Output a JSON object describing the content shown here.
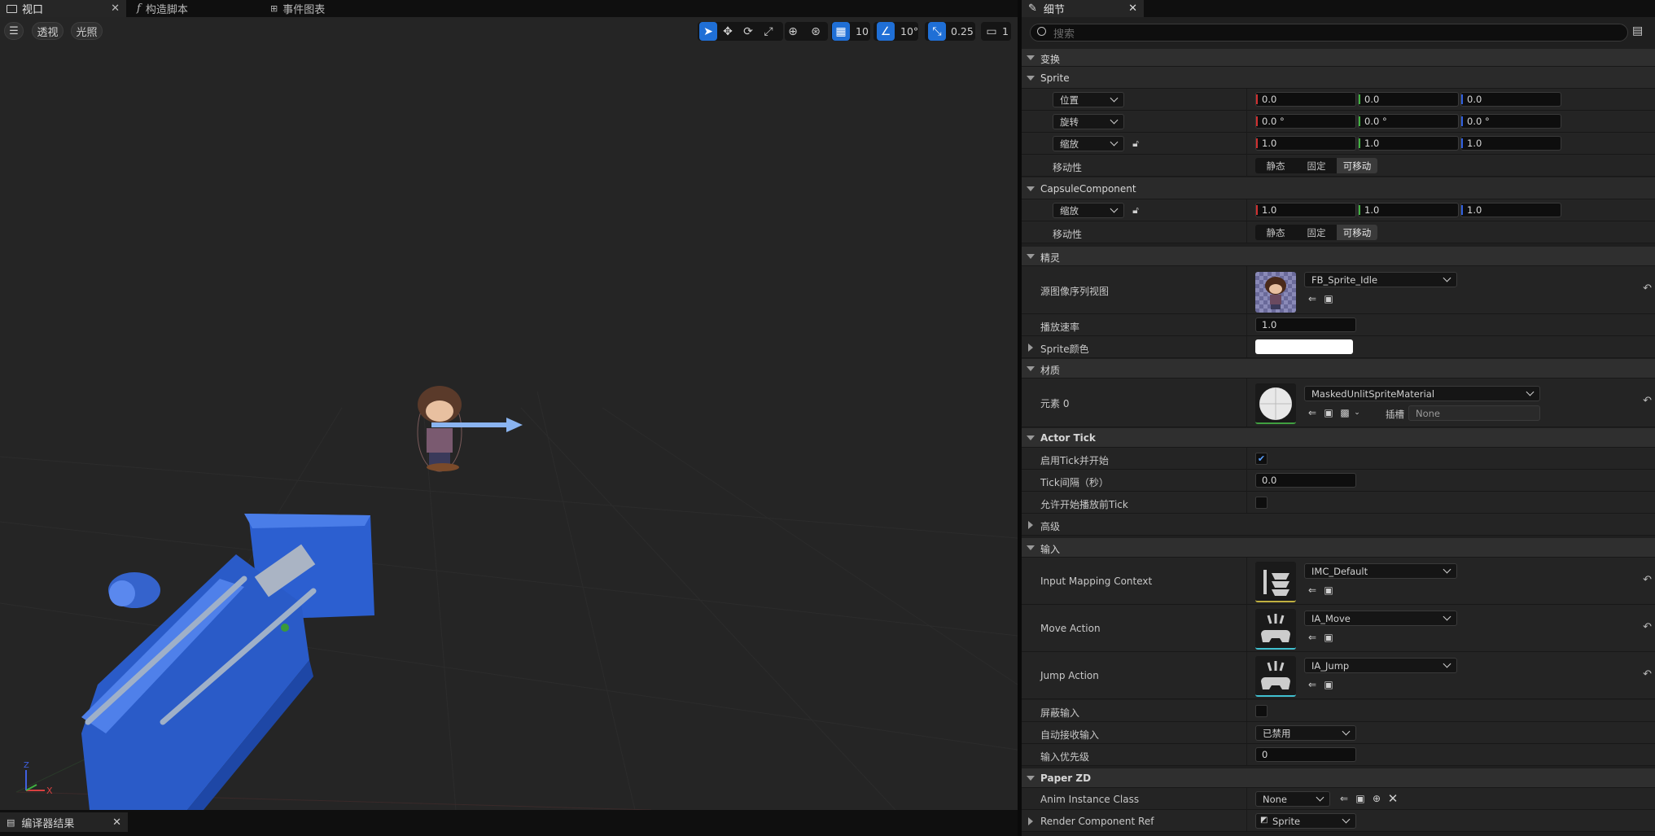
{
  "left_tabs": [
    {
      "label": "视口",
      "icon": "viewport-icon"
    },
    {
      "label": "构造脚本",
      "icon": "function-icon"
    },
    {
      "label": "事件图表",
      "icon": "event-graph-icon"
    }
  ],
  "viewport": {
    "view_mode": "透视",
    "lighting": "光照",
    "grid_snap": "10",
    "rotation_snap": "10°",
    "scale_snap": "0.25",
    "camera_speed": "1",
    "axis_x": "X",
    "axis_z": "Z"
  },
  "bottom_tab": {
    "label": "编译器结果"
  },
  "details": {
    "tab_label": "细节",
    "search_placeholder": "搜索",
    "sections": {
      "transform": "变换",
      "sprite": "Sprite",
      "capsule": "CapsuleComponent",
      "sprite_cn": "精灵",
      "material": "材质",
      "actor_tick": "Actor Tick",
      "advanced": "高级",
      "input": "输入",
      "paper_zd": "Paper ZD"
    },
    "transform": {
      "location_label": "位置",
      "location": [
        "0.0",
        "0.0",
        "0.0"
      ],
      "rotation_label": "旋转",
      "rotation": [
        "0.0 °",
        "0.0 °",
        "0.0 °"
      ],
      "scale_label": "缩放",
      "scale": [
        "1.0",
        "1.0",
        "1.0"
      ],
      "mobility_label": "移动性",
      "mobility_options": [
        "静态",
        "固定",
        "可移动"
      ]
    },
    "capsule": {
      "scale_label": "缩放",
      "scale": [
        "1.0",
        "1.0",
        "1.0"
      ],
      "mobility_label": "移动性",
      "mobility_options": [
        "静态",
        "固定",
        "可移动"
      ]
    },
    "sprite": {
      "source_flipbook_label": "源图像序列视图",
      "source_flipbook": "FB_Sprite_Idle",
      "play_rate_label": "播放速率",
      "play_rate": "1.0",
      "color_label": "Sprite颜色"
    },
    "material": {
      "element_label": "元素 0",
      "element_value": "MaskedUnlitSpriteMaterial",
      "slot_label": "插槽",
      "slot_value": "None"
    },
    "actor_tick": {
      "start_label": "启用Tick并开始",
      "interval_label": "Tick间隔（秒）",
      "interval": "0.0",
      "before_play_label": "允许开始播放前Tick"
    },
    "input": {
      "imc_label": "Input Mapping Context",
      "imc_value": "IMC_Default",
      "move_label": "Move Action",
      "move_value": "IA_Move",
      "jump_label": "Jump Action",
      "jump_value": "IA_Jump",
      "block_label": "屏蔽输入",
      "auto_receive_label": "自动接收输入",
      "auto_receive_value": "已禁用",
      "priority_label": "输入优先级",
      "priority_value": "0"
    },
    "paper_zd": {
      "anim_class_label": "Anim Instance Class",
      "anim_class_value": "None",
      "render_ref_label": "Render Component Ref",
      "render_ref_value": "Sprite"
    }
  }
}
